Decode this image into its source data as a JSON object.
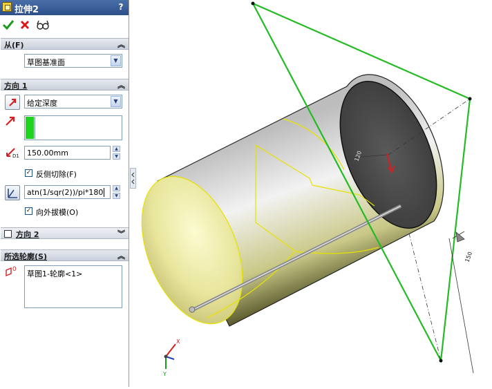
{
  "feature": {
    "title": "拉伸2",
    "help": "?"
  },
  "actions": {
    "ok_icon": "checkmark-icon",
    "cancel_icon": "x-icon",
    "preview_icon": "glasses-icon"
  },
  "from_section": {
    "header": "从(F)",
    "start_condition": "草图基准面"
  },
  "direction1": {
    "header": "方向 1",
    "end_condition": "给定深度",
    "depth": "150.00mm",
    "flip_side_to_cut_label": "反侧切除(F)",
    "flip_side_to_cut": true,
    "draft_angle": "atn(1/sqr(2))/pi*180",
    "draft_outward_label": "向外拔模(O)",
    "draft_outward": true
  },
  "direction2": {
    "header": "方向 2",
    "enabled": false
  },
  "selected_contours": {
    "header": "所选轮廓(S)",
    "items": [
      "草图1-轮廓<1>"
    ]
  },
  "viewport": {
    "triad_x": "X",
    "triad_y": "Y",
    "dim_label_1": "120",
    "dim_label_2": "150"
  },
  "colors": {
    "titlebar": "#2c4f8a",
    "cylinder_face": "#e9e6a0",
    "end_face": "#454545",
    "plane_edge": "#22bb22",
    "sketch_edge": "#e6e200",
    "flip_arrow": "#d42020"
  }
}
